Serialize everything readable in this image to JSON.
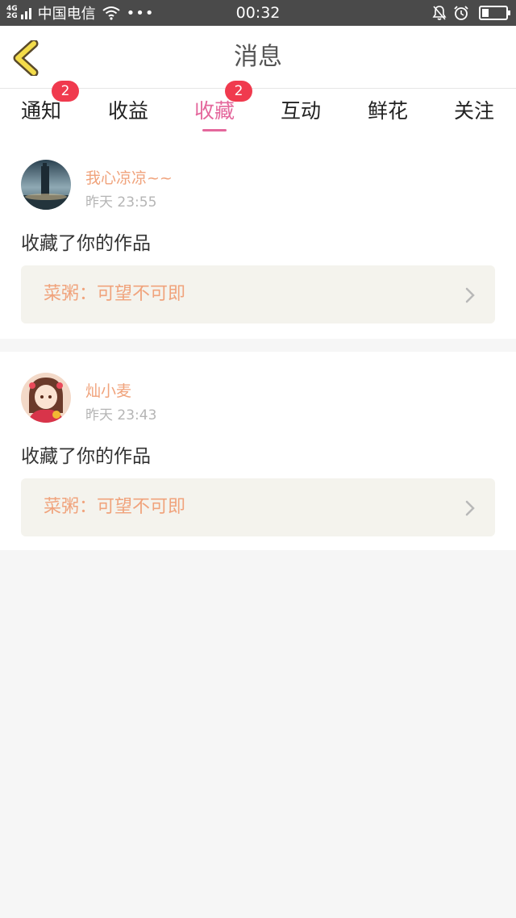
{
  "status_bar": {
    "network_top": "4G",
    "network_bottom": "2G",
    "carrier": "中国电信",
    "more": "•••",
    "time": "00:32",
    "battery_level": 0.3
  },
  "header": {
    "title": "消息"
  },
  "tabs": [
    {
      "label": "通知",
      "badge": "2",
      "active": false
    },
    {
      "label": "收益",
      "badge": "",
      "active": false
    },
    {
      "label": "收藏",
      "badge": "2",
      "active": true
    },
    {
      "label": "互动",
      "badge": "",
      "active": false
    },
    {
      "label": "鲜花",
      "badge": "",
      "active": false
    },
    {
      "label": "关注",
      "badge": "",
      "active": false
    }
  ],
  "messages": [
    {
      "username": "我心凉凉~~",
      "time": "昨天 23:55",
      "action": "收藏了你的作品",
      "work_title": "菜粥：可望不可即"
    },
    {
      "username": "灿小麦",
      "time": "昨天 23:43",
      "action": "收藏了你的作品",
      "work_title": "菜粥：可望不可即"
    }
  ],
  "colors": {
    "accent_pink": "#e4679c",
    "badge_red": "#f03a4e",
    "username_orange": "#f0a37c",
    "link_background": "#f4f3ed"
  }
}
